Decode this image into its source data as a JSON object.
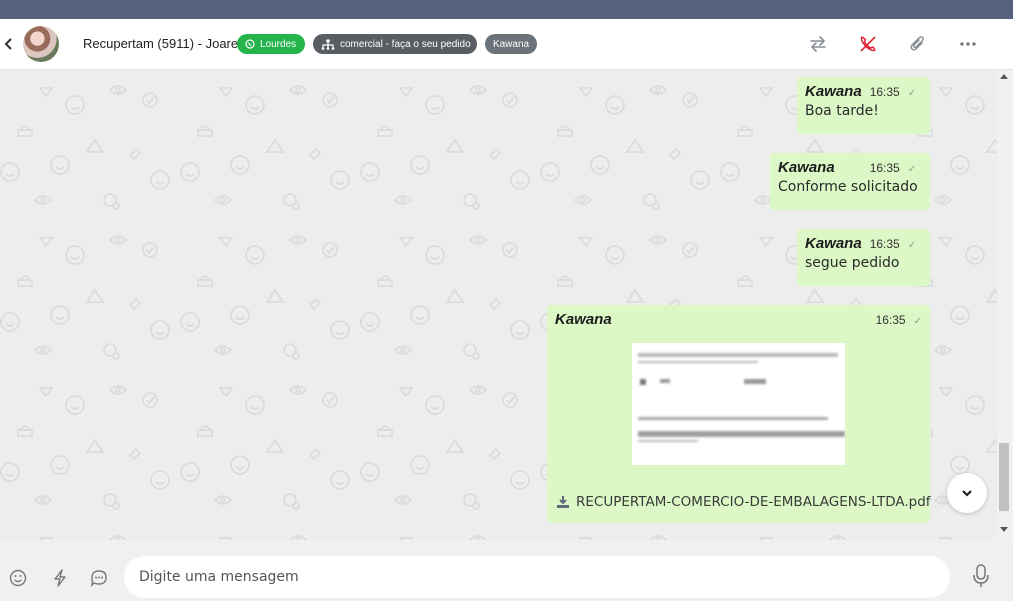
{
  "header": {
    "contact_name": "Recupertam (5911) - Joarez",
    "tags": [
      {
        "label": "Lourdes",
        "color": "#25b34b",
        "icon": "whatsapp-icon"
      },
      {
        "label": "comercial - faça o seu pedido",
        "color": "#5a5e64",
        "icon": "sitemap-icon"
      },
      {
        "label": "Kawana",
        "color": "#6c727a"
      }
    ],
    "actions": [
      "transfer-icon",
      "end-call-icon",
      "attach-icon",
      "more-icon"
    ]
  },
  "messages": [
    {
      "sender": "Kawana",
      "time": "16:35",
      "text": "Boa tarde!"
    },
    {
      "sender": "Kawana",
      "time": "16:35",
      "text": "Conforme solicitado"
    },
    {
      "sender": "Kawana",
      "time": "16:35",
      "text": "segue pedido"
    },
    {
      "sender": "Kawana",
      "time": "16:35",
      "file_name": "RECUPERTAM-COMERCIO-DE-EMBALAGENS-LTDA.pdf"
    }
  ],
  "composer": {
    "placeholder": "Digite uma mensagem",
    "icons": [
      "emoji-icon",
      "lightning-icon",
      "quick-reply-icon",
      "microphone-icon"
    ]
  },
  "colors": {
    "top_strip": "#55627f",
    "outgoing_bubble": "#dcf8c6",
    "chat_background": "#ededed",
    "end_call": "#e0263a"
  }
}
